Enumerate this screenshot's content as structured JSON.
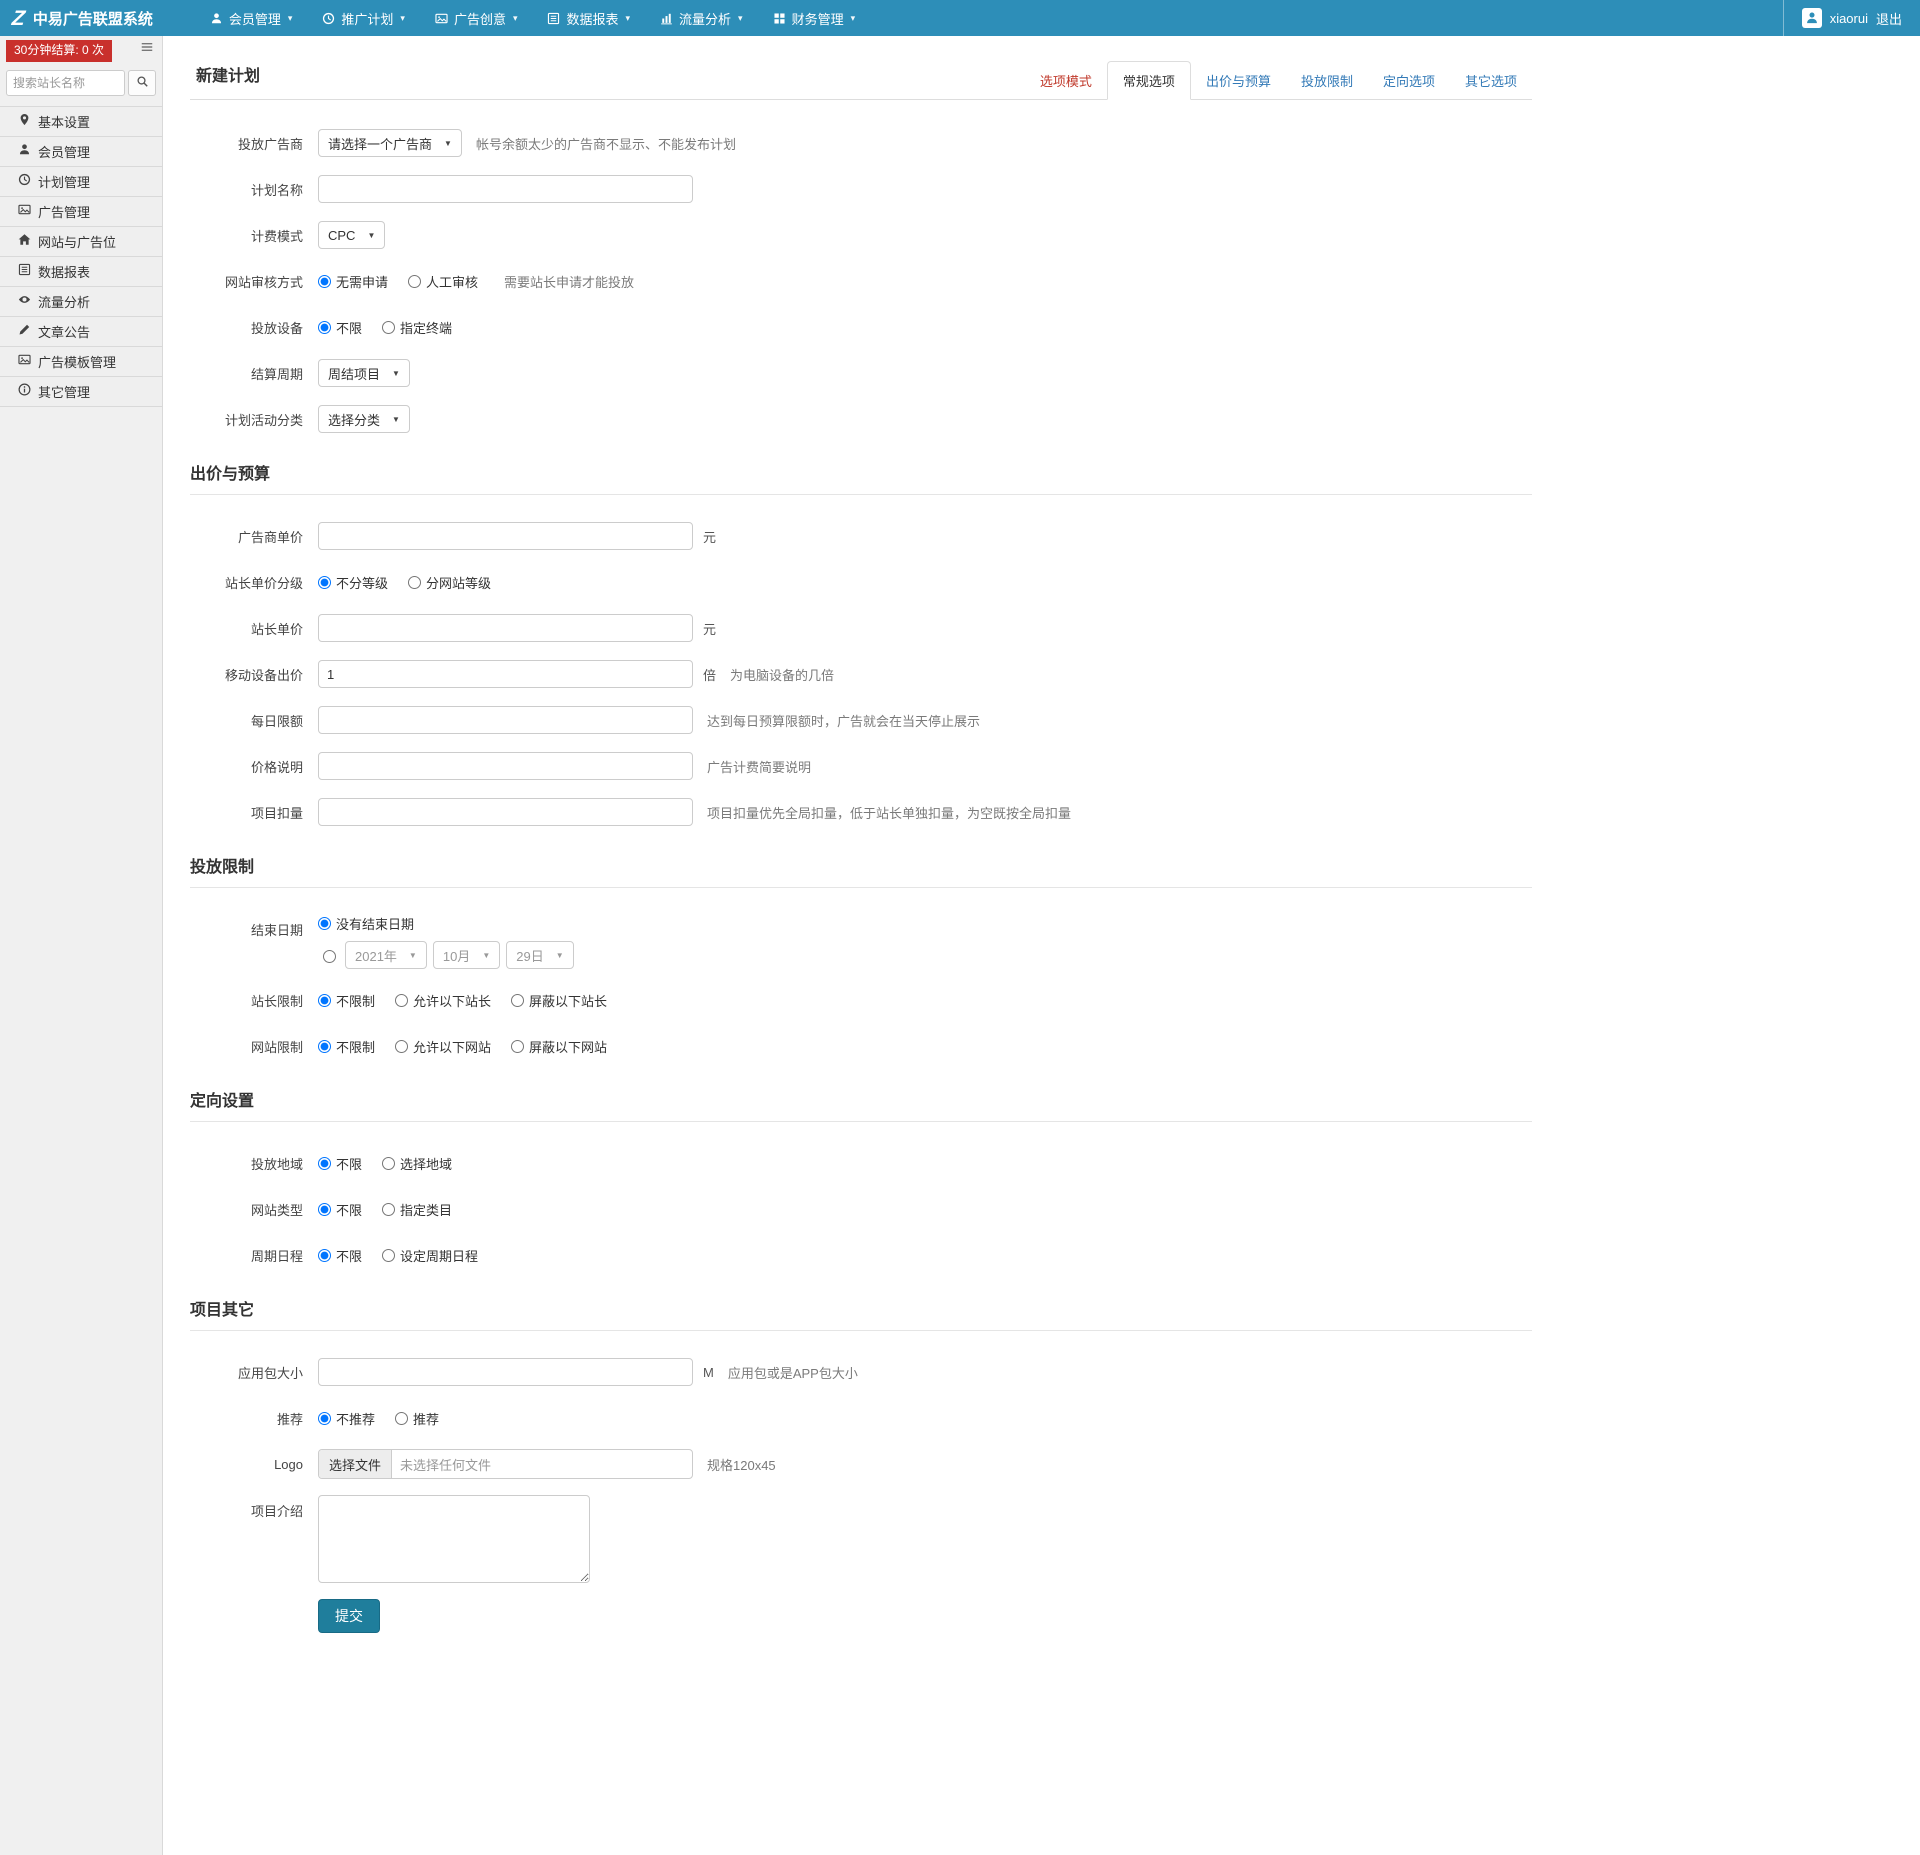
{
  "colors": {
    "navbar": "#2d8eb8",
    "badge": "#c9302c",
    "link_blue": "#337ab7",
    "tab_red": "#c0392b",
    "submit_teal": "#1f7e9c"
  },
  "navbar": {
    "brand": "中易广告联盟系统",
    "logo_glyph": "Z",
    "menus": [
      {
        "name": "nav-member-management",
        "icon": "user",
        "label": "会员管理"
      },
      {
        "name": "nav-promotion-plan",
        "icon": "clock",
        "label": "推广计划"
      },
      {
        "name": "nav-ad-creative",
        "icon": "image",
        "label": "广告创意"
      },
      {
        "name": "nav-data-report",
        "icon": "list",
        "label": "数据报表"
      },
      {
        "name": "nav-traffic-analysis",
        "icon": "chart",
        "label": "流量分析"
      },
      {
        "name": "nav-finance-management",
        "icon": "grid",
        "label": "财务管理"
      }
    ],
    "username": "xiaorui",
    "logout_label": "退出"
  },
  "sidebar": {
    "badge": "30分钟结算: 0 次",
    "search_placeholder": "搜索站长名称",
    "items": [
      {
        "name": "sidebar-item-basic-settings",
        "icon": "pin",
        "label": "基本设置"
      },
      {
        "name": "sidebar-item-member-management",
        "icon": "user",
        "label": "会员管理"
      },
      {
        "name": "sidebar-item-plan-management",
        "icon": "clock",
        "label": "计划管理"
      },
      {
        "name": "sidebar-item-ad-management",
        "icon": "image",
        "label": "广告管理"
      },
      {
        "name": "sidebar-item-sites-adslots",
        "icon": "home",
        "label": "网站与广告位"
      },
      {
        "name": "sidebar-item-data-report",
        "icon": "list",
        "label": "数据报表"
      },
      {
        "name": "sidebar-item-traffic-analysis",
        "icon": "eye",
        "label": "流量分析"
      },
      {
        "name": "sidebar-item-article-notice",
        "icon": "pencil",
        "label": "文章公告"
      },
      {
        "name": "sidebar-item-ad-template",
        "icon": "image",
        "label": "广告模板管理"
      },
      {
        "name": "sidebar-item-other-management",
        "icon": "info",
        "label": "其它管理"
      }
    ]
  },
  "page": {
    "title": "新建计划",
    "tabs": [
      {
        "name": "tab-option-mode",
        "label": "选项模式",
        "style": "danger"
      },
      {
        "name": "tab-general-options",
        "label": "常规选项",
        "style": "active"
      },
      {
        "name": "tab-bid-budget",
        "label": "出价与预算",
        "style": "link"
      },
      {
        "name": "tab-delivery-limit",
        "label": "投放限制",
        "style": "link"
      },
      {
        "name": "tab-targeting-options",
        "label": "定向选项",
        "style": "link"
      },
      {
        "name": "tab-other-options",
        "label": "其它选项",
        "style": "link"
      }
    ]
  },
  "form": {
    "sections": [
      {
        "title": "",
        "rows": [
          {
            "type": "select",
            "name": "advertiser",
            "label": "投放广告商",
            "value": "请选择一个广告商",
            "hint": "帐号余额太少的广告商不显示、不能发布计划"
          },
          {
            "type": "input",
            "name": "plan-name",
            "label": "计划名称",
            "value": ""
          },
          {
            "type": "select",
            "name": "billing-mode",
            "label": "计费模式",
            "value": "CPC"
          },
          {
            "type": "radios",
            "name": "site-audit",
            "label": "网站审核方式",
            "options": [
              {
                "label": "无需申请",
                "checked": true
              },
              {
                "label": "人工审核",
                "checked": false
              }
            ],
            "hint": "需要站长申请才能投放"
          },
          {
            "type": "radios",
            "name": "device",
            "label": "投放设备",
            "options": [
              {
                "label": "不限",
                "checked": true
              },
              {
                "label": "指定终端",
                "checked": false
              }
            ]
          },
          {
            "type": "select",
            "name": "settle-cycle",
            "label": "结算周期",
            "value": "周结项目"
          },
          {
            "type": "select",
            "name": "plan-category",
            "label": "计划活动分类",
            "value": "选择分类"
          }
        ]
      },
      {
        "title": "出价与预算",
        "rows": [
          {
            "type": "input",
            "name": "advertiser-price",
            "label": "广告商单价",
            "value": "",
            "suffix": "元"
          },
          {
            "type": "radios",
            "name": "webmaster-price-grade",
            "label": "站长单价分级",
            "options": [
              {
                "label": "不分等级",
                "checked": true
              },
              {
                "label": "分网站等级",
                "checked": false
              }
            ]
          },
          {
            "type": "input",
            "name": "webmaster-price",
            "label": "站长单价",
            "value": "",
            "suffix": "元"
          },
          {
            "type": "input",
            "name": "mobile-bid",
            "label": "移动设备出价",
            "value": "1",
            "suffix": "倍",
            "hint": "为电脑设备的几倍"
          },
          {
            "type": "input",
            "name": "daily-limit",
            "label": "每日限额",
            "value": "",
            "hint": "达到每日预算限额时，广告就会在当天停止展示"
          },
          {
            "type": "input",
            "name": "price-desc",
            "label": "价格说明",
            "value": "",
            "hint": "广告计费简要说明"
          },
          {
            "type": "input",
            "name": "project-deduction",
            "label": "项目扣量",
            "value": "",
            "hint": "项目扣量优先全局扣量，低于站长单独扣量，为空既按全局扣量"
          }
        ]
      },
      {
        "title": "投放限制",
        "rows": [
          {
            "type": "date-radio",
            "name": "end-date",
            "label": "结束日期",
            "option1": "没有结束日期",
            "option1_checked": true,
            "year": "2021年",
            "month": "10月",
            "day": "29日"
          },
          {
            "type": "radios",
            "name": "webmaster-limit",
            "label": "站长限制",
            "options": [
              {
                "label": "不限制",
                "checked": true
              },
              {
                "label": "允许以下站长",
                "checked": false
              },
              {
                "label": "屏蔽以下站长",
                "checked": false
              }
            ]
          },
          {
            "type": "radios",
            "name": "website-limit",
            "label": "网站限制",
            "options": [
              {
                "label": "不限制",
                "checked": true
              },
              {
                "label": "允许以下网站",
                "checked": false
              },
              {
                "label": "屏蔽以下网站",
                "checked": false
              }
            ]
          }
        ]
      },
      {
        "title": "定向设置",
        "rows": [
          {
            "type": "radios",
            "name": "region",
            "label": "投放地域",
            "options": [
              {
                "label": "不限",
                "checked": true
              },
              {
                "label": "选择地域",
                "checked": false
              }
            ]
          },
          {
            "type": "radios",
            "name": "site-type",
            "label": "网站类型",
            "options": [
              {
                "label": "不限",
                "checked": true
              },
              {
                "label": "指定类目",
                "checked": false
              }
            ]
          },
          {
            "type": "radios",
            "name": "schedule",
            "label": "周期日程",
            "options": [
              {
                "label": "不限",
                "checked": true
              },
              {
                "label": "设定周期日程",
                "checked": false
              }
            ]
          }
        ]
      },
      {
        "title": "项目其它",
        "rows": [
          {
            "type": "input",
            "name": "app-size",
            "label": "应用包大小",
            "value": "",
            "suffix": "M",
            "hint": "应用包或是APP包大小"
          },
          {
            "type": "radios",
            "name": "recommend",
            "label": "推荐",
            "options": [
              {
                "label": "不推荐",
                "checked": true
              },
              {
                "label": "推荐",
                "checked": false
              }
            ]
          },
          {
            "type": "file",
            "name": "logo",
            "label": "Logo",
            "button": "选择文件",
            "filename": "未选择任何文件",
            "hint": "规格120x45"
          },
          {
            "type": "textarea",
            "name": "project-intro",
            "label": "项目介绍",
            "value": ""
          },
          {
            "type": "submit",
            "name": "submit",
            "button": "提交"
          }
        ]
      }
    ]
  }
}
